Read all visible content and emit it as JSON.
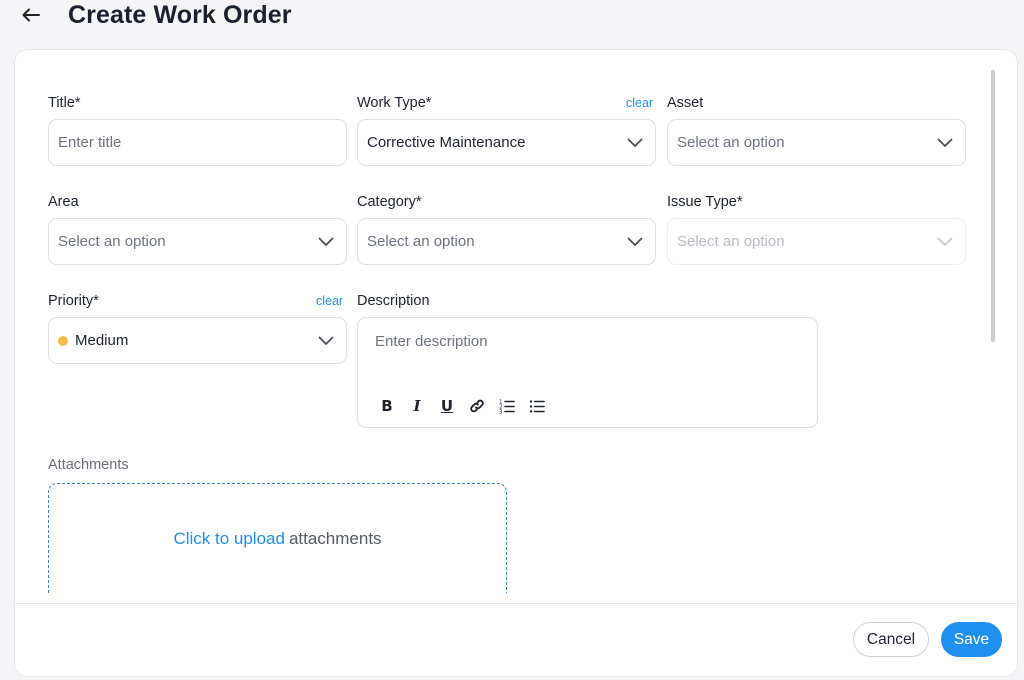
{
  "header": {
    "back_icon": "arrow-left-icon",
    "title": "Create Work Order"
  },
  "form": {
    "title": {
      "label": "Title*",
      "placeholder": "Enter title",
      "value": ""
    },
    "work_type": {
      "label": "Work Type*",
      "clear": "clear",
      "value": "Corrective Maintenance"
    },
    "asset": {
      "label": "Asset",
      "placeholder": "Select an option"
    },
    "area": {
      "label": "Area",
      "placeholder": "Select an option"
    },
    "category": {
      "label": "Category*",
      "placeholder": "Select an option"
    },
    "issue_type": {
      "label": "Issue Type*",
      "placeholder": "Select an option",
      "disabled": true
    },
    "priority": {
      "label": "Priority*",
      "clear": "clear",
      "value": "Medium",
      "dot_color": "#f8bb4e"
    },
    "description": {
      "label": "Description",
      "placeholder": "Enter description",
      "toolbar": {
        "bold": "B",
        "italic": "I",
        "underline": "U",
        "link_icon": "link-icon",
        "ordered_list_icon": "ordered-list-icon",
        "bullet_list_icon": "bullet-list-icon"
      }
    },
    "attachments": {
      "label": "Attachments",
      "upload_link": "Click to upload",
      "upload_rest": "attachments"
    }
  },
  "footer": {
    "cancel_label": "Cancel",
    "save_label": "Save"
  },
  "colors": {
    "accent": "#1f8ff0",
    "priority_medium": "#f8bb4e"
  }
}
